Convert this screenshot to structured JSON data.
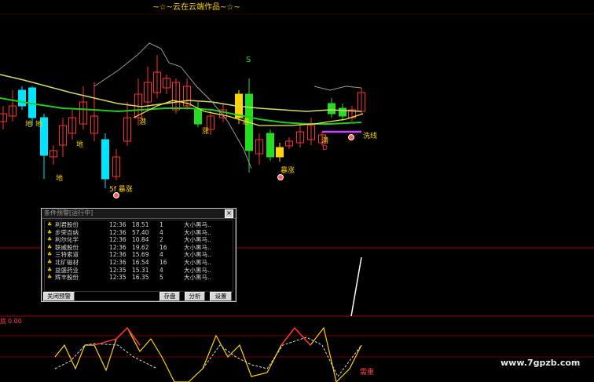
{
  "header": {
    "title": "~☆~云在云端作品~☆~"
  },
  "signals": [
    {
      "text": "S",
      "style": "green"
    },
    {
      "text": "地"
    },
    {
      "text": "地"
    },
    {
      "text": "地"
    },
    {
      "text": "地"
    },
    {
      "text": "潜"
    },
    {
      "text": "5f 暴涨"
    },
    {
      "text": "涨"
    },
    {
      "text": "潜"
    },
    {
      "text": "暴涨"
    },
    {
      "text": "潜"
    },
    {
      "text": "D"
    },
    {
      "text": "洗线"
    }
  ],
  "indicator": {
    "label": "底",
    "value": "0.00"
  },
  "indicator_lower_label": "需重",
  "watermark": "www.7gpzb.com",
  "colors": {
    "background": "#000000",
    "accent": "#ffd400",
    "up": "#ff3030",
    "down": "#00e5ff",
    "border": "#ff0000"
  },
  "alert_dialog": {
    "title": "条件预警[运行中]",
    "close_icon": "close-icon",
    "rows": [
      {
        "name": "利君股份",
        "time": "12:36",
        "price": "18.51",
        "count": "1",
        "note": "大小黑马.."
      },
      {
        "name": "步荣百纳",
        "time": "12:36",
        "price": "57.40",
        "count": "4",
        "note": "大小黑马.."
      },
      {
        "name": "利尔化学",
        "time": "12:36",
        "price": "10.84",
        "count": "2",
        "note": "大小黑马.."
      },
      {
        "name": "联威股份",
        "time": "12:36",
        "price": "19.62",
        "count": "16",
        "note": "大小黑马.."
      },
      {
        "name": "三特索道",
        "time": "12:36",
        "price": "15.69",
        "count": "4",
        "note": "大小黑马.."
      },
      {
        "name": "北矿磁材",
        "time": "12:36",
        "price": "16.54",
        "count": "16",
        "note": "大小黑马.."
      },
      {
        "name": "益盛药业",
        "time": "12:35",
        "price": "15.31",
        "count": "4",
        "note": "大小黑马.."
      },
      {
        "name": "辉丰股份",
        "time": "12:35",
        "price": "16.35",
        "count": "5",
        "note": "大小黑马.."
      }
    ],
    "buttons": {
      "close_alert": "关闭预警",
      "save": "存盘",
      "analyze": "分析",
      "settings": "设置"
    }
  }
}
